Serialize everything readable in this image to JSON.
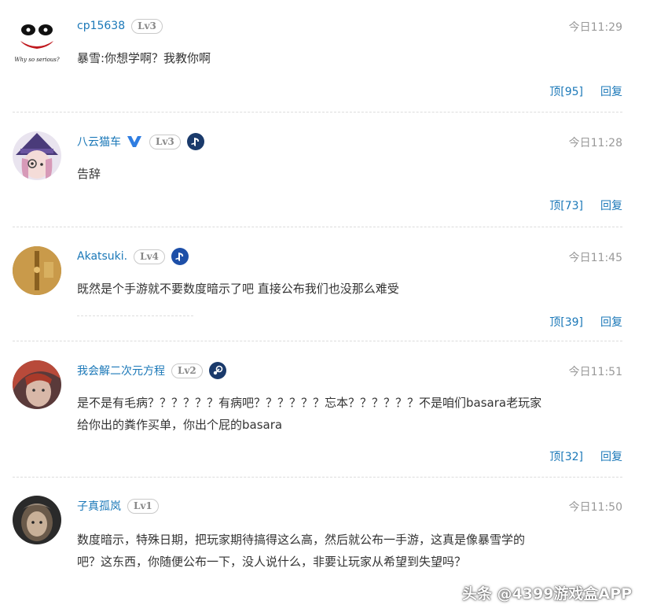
{
  "comments": [
    {
      "user": "cp15638",
      "level": "Lv3",
      "time": "今日11:29",
      "text": "暴雪:你想学啊？我教你啊",
      "upvote": "顶[95]",
      "reply": "回复"
    },
    {
      "user": "八云猫车",
      "level": "Lv3",
      "time": "今日11:28",
      "text": "告辞",
      "upvote": "顶[73]",
      "reply": "回复"
    },
    {
      "user": "Akatsuki.",
      "level": "Lv4",
      "time": "今日11:45",
      "text": "既然是个手游就不要数度暗示了吧 直接公布我们也没那么难受",
      "upvote": "顶[39]",
      "reply": "回复"
    },
    {
      "user": "我会解二次元方程",
      "level": "Lv2",
      "time": "今日11:51",
      "text_line1": "是不是有毛病？？？？？？有病吧？？？？？？忘本？？？？？？不是咱们basara老玩家",
      "text_line2": "给你出的粪作买单，你出个屁的basara",
      "upvote": "顶[32]",
      "reply": "回复"
    },
    {
      "user": "子真孤岚",
      "level": "Lv1",
      "time": "今日11:50",
      "text_line1": "数度暗示，特殊日期，把玩家期待搞得这么高，然后就公布一手游，这真是像暴雪学的",
      "text_line2": "吧？这东西，你随便公布一下，没人说什么，非要让玩家从希望到失望吗？"
    }
  ],
  "avatar_caption": "Why so serious?",
  "watermark": "头条 @4399游戏盒APP",
  "colors": {
    "link": "#1b78b8",
    "time": "#999999",
    "text": "#333333",
    "playstation": "#1d4fa8",
    "steam": "#1a3a6b",
    "vip": "#2f7de1"
  }
}
